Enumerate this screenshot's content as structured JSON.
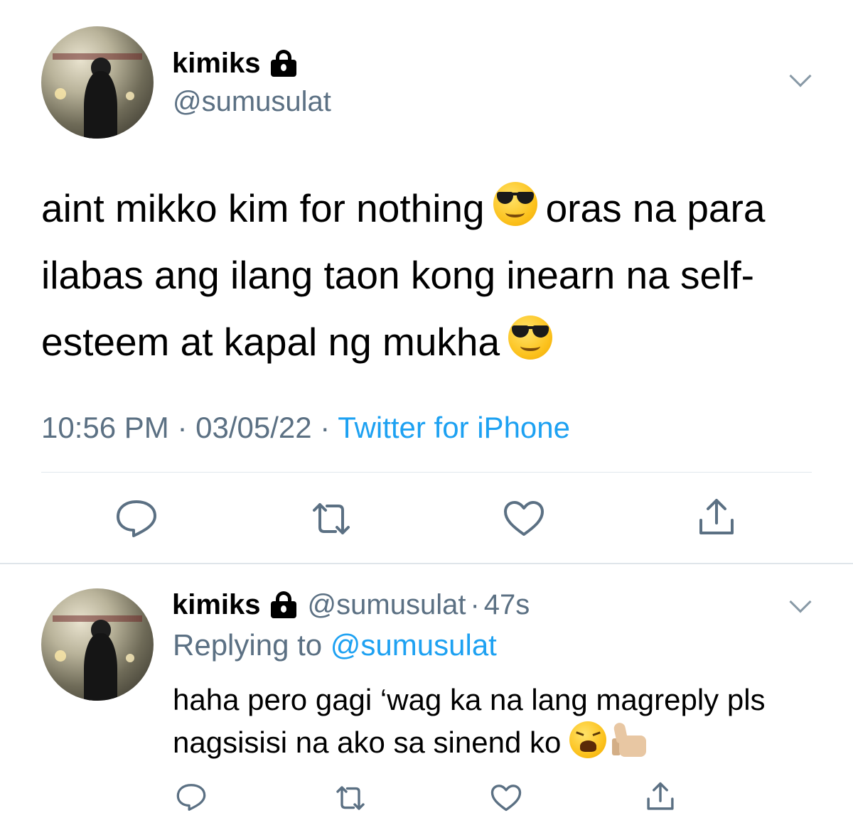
{
  "main_tweet": {
    "display_name": "kimiks",
    "handle": "@sumusulat",
    "text_part1": "aint mikko kim for nothing",
    "text_part2": "oras na para ilabas ang ilang taon kong inearn na self-esteem at kapal ng mukha",
    "time": "10:56 PM",
    "sep1": " · ",
    "date": "03/05/22",
    "sep2": " · ",
    "source": "Twitter for iPhone"
  },
  "reply_tweet": {
    "display_name": "kimiks",
    "handle": "@sumusulat",
    "dot": "·",
    "time_ago": "47s",
    "replying_label": "Replying to ",
    "replying_mention": "@sumusulat",
    "text": "haha pero gagi ‘wag ka na lang magreply pls nagsisisi na ako sa sinend ko"
  },
  "icons": {
    "lock": "lock-icon",
    "chevron": "chevron-down-icon",
    "reply": "reply-icon",
    "retweet": "retweet-icon",
    "like": "heart-icon",
    "share": "share-icon",
    "emoji_cool": "smiling-face-with-sunglasses-emoji",
    "emoji_weary": "weary-face-emoji",
    "emoji_thumbs": "thumbs-up-emoji"
  },
  "colors": {
    "text": "#000000",
    "secondary": "#5b7083",
    "link": "#1da1f2",
    "divider": "#e1e8ed"
  }
}
